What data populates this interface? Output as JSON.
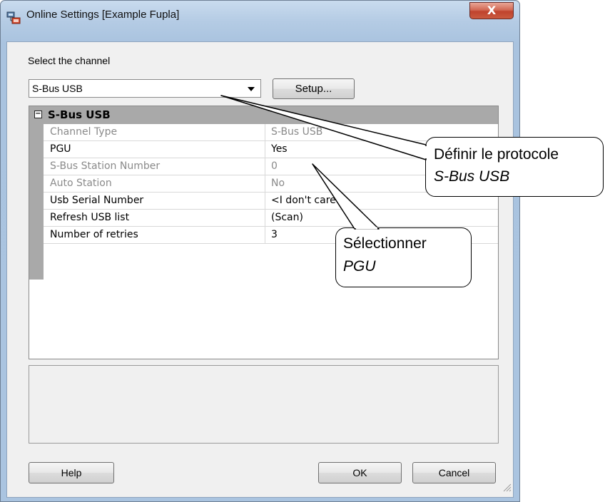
{
  "window": {
    "title": "Online Settings [Example Fupla]",
    "close_glyph": "X"
  },
  "channel": {
    "label": "Select the channel",
    "selected": "S-Bus USB",
    "setup_label": "Setup..."
  },
  "grid": {
    "category": "S-Bus USB",
    "toggle_glyph": "−",
    "rows": [
      {
        "name": "Channel Type",
        "value": "S-Bus USB",
        "enabled": false
      },
      {
        "name": "PGU",
        "value": "Yes",
        "enabled": true
      },
      {
        "name": "S-Bus Station Number",
        "value": "0",
        "enabled": false
      },
      {
        "name": "Auto Station",
        "value": "No",
        "enabled": false
      },
      {
        "name": "Usb Serial Number",
        "value": "<I don't care>",
        "enabled": true
      },
      {
        "name": "Refresh USB list",
        "value": "(Scan)",
        "enabled": true
      },
      {
        "name": "Number of retries",
        "value": "3",
        "enabled": true
      }
    ]
  },
  "buttons": {
    "help": "Help",
    "ok": "OK",
    "cancel": "Cancel"
  },
  "callouts": {
    "protocol": {
      "line1": "Définir le protocole",
      "line2": "S-Bus USB"
    },
    "pgu": {
      "line1": "Sélectionner",
      "line2": "PGU"
    }
  },
  "colors": {
    "close_button": "#c0432d",
    "category_band": "#a9a9a9",
    "disabled_text": "#8a8a8a"
  },
  "icons": {
    "app": "network-settings-icon",
    "close": "close-icon",
    "dropdown": "chevron-down-icon",
    "resize": "resize-grip-icon",
    "collapse": "collapse-icon"
  }
}
